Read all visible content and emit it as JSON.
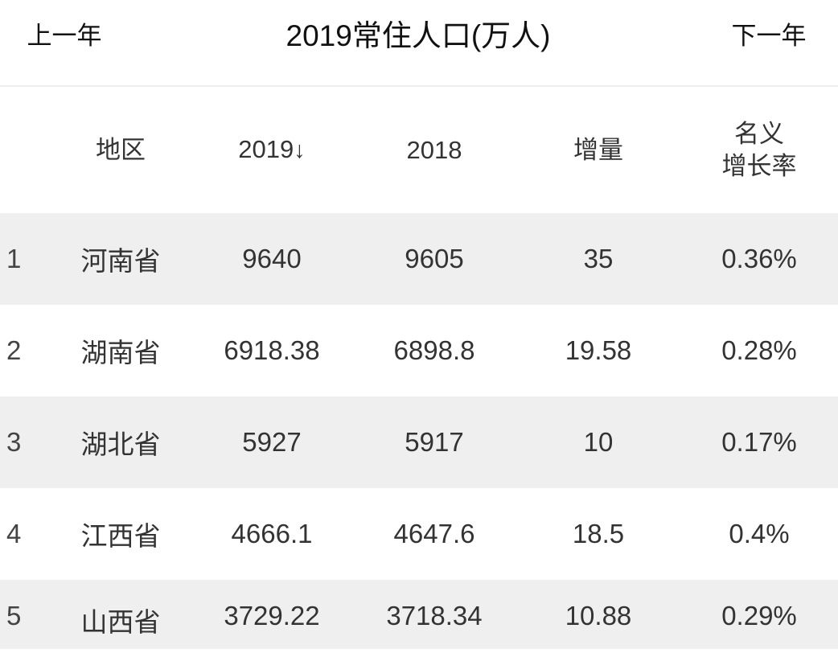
{
  "header": {
    "prev_label": "上一年",
    "title": "2019常住人口(万人)",
    "next_label": "下一年"
  },
  "table": {
    "columns": {
      "index": "",
      "area": "地区",
      "year2019": "2019",
      "year2019_sort": "↓",
      "year2018": "2018",
      "delta": "增量",
      "rate_line1": "名义",
      "rate_line2": "增长率"
    },
    "rows": [
      {
        "index": "1",
        "area": "河南省",
        "y2019": "9640",
        "y2018": "9605",
        "delta": "35",
        "rate": "0.36%"
      },
      {
        "index": "2",
        "area": "湖南省",
        "y2019": "6918.38",
        "y2018": "6898.8",
        "delta": "19.58",
        "rate": "0.28%"
      },
      {
        "index": "3",
        "area": "湖北省",
        "y2019": "5927",
        "y2018": "5917",
        "delta": "10",
        "rate": "0.17%"
      },
      {
        "index": "4",
        "area": "江西省",
        "y2019": "4666.1",
        "y2018": "4647.6",
        "delta": "18.5",
        "rate": "0.4%"
      },
      {
        "index": "5",
        "area": "山西省",
        "y2019": "3729.22",
        "y2018": "3718.34",
        "delta": "10.88",
        "rate": "0.29%"
      }
    ]
  },
  "colors": {
    "row_alt_background": "#efefef",
    "background": "#ffffff",
    "text": "#333333",
    "divider": "#efefef"
  }
}
